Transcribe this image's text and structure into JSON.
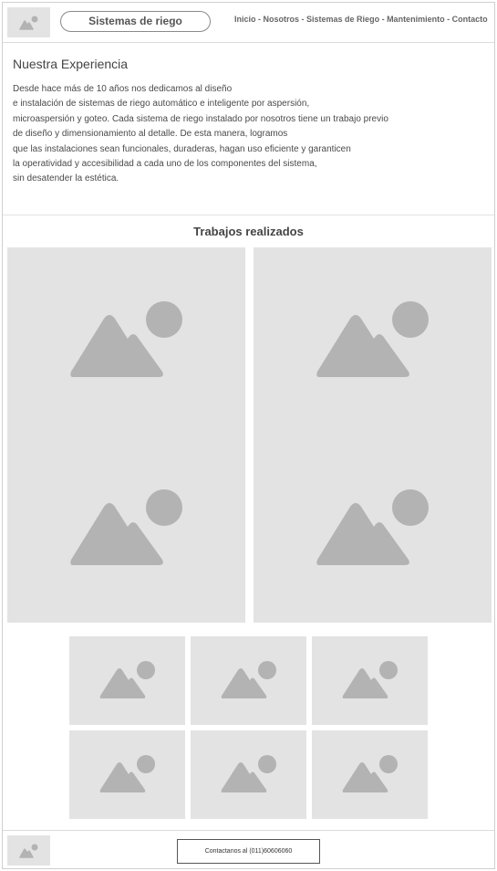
{
  "header": {
    "logo_icon": "image-placeholder-icon",
    "brand": "Sistemas de riego",
    "nav": [
      {
        "label": "Inicio"
      },
      {
        "label": "Nosotros"
      },
      {
        "label": "Sistemas de Riego"
      },
      {
        "label": "Mantenimiento"
      },
      {
        "label": "Contacto"
      }
    ],
    "nav_separator": " - "
  },
  "experience": {
    "title": "Nuestra Experiencia",
    "lines": [
      "Desde hace más de 10 años nos dedicamos al diseño",
      "e instalación de sistemas de riego automático e inteligente por aspersión,",
      "microaspersión y goteo. Cada sistema de riego instalado por nosotros tiene un trabajo previo",
      "de diseño y dimensionamiento al detalle. De esta manera, logramos",
      "que las instalaciones sean funcionales, duraderas, hagan uso eficiente y garanticen",
      "la operatividad y accesibilidad a cada uno de los componentes del sistema,",
      "sin desatender la estética."
    ]
  },
  "works": {
    "title": "Trabajos realizados",
    "large_images": 4,
    "small_images": 6,
    "image_icon": "image-placeholder-icon"
  },
  "footer": {
    "logo_icon": "image-placeholder-icon",
    "contact_label": "Contactanos al (011)60606060"
  },
  "colors": {
    "placeholder_bg": "#e3e3e3",
    "placeholder_icon": "#b3b3b3",
    "border": "#dcdcdc"
  }
}
